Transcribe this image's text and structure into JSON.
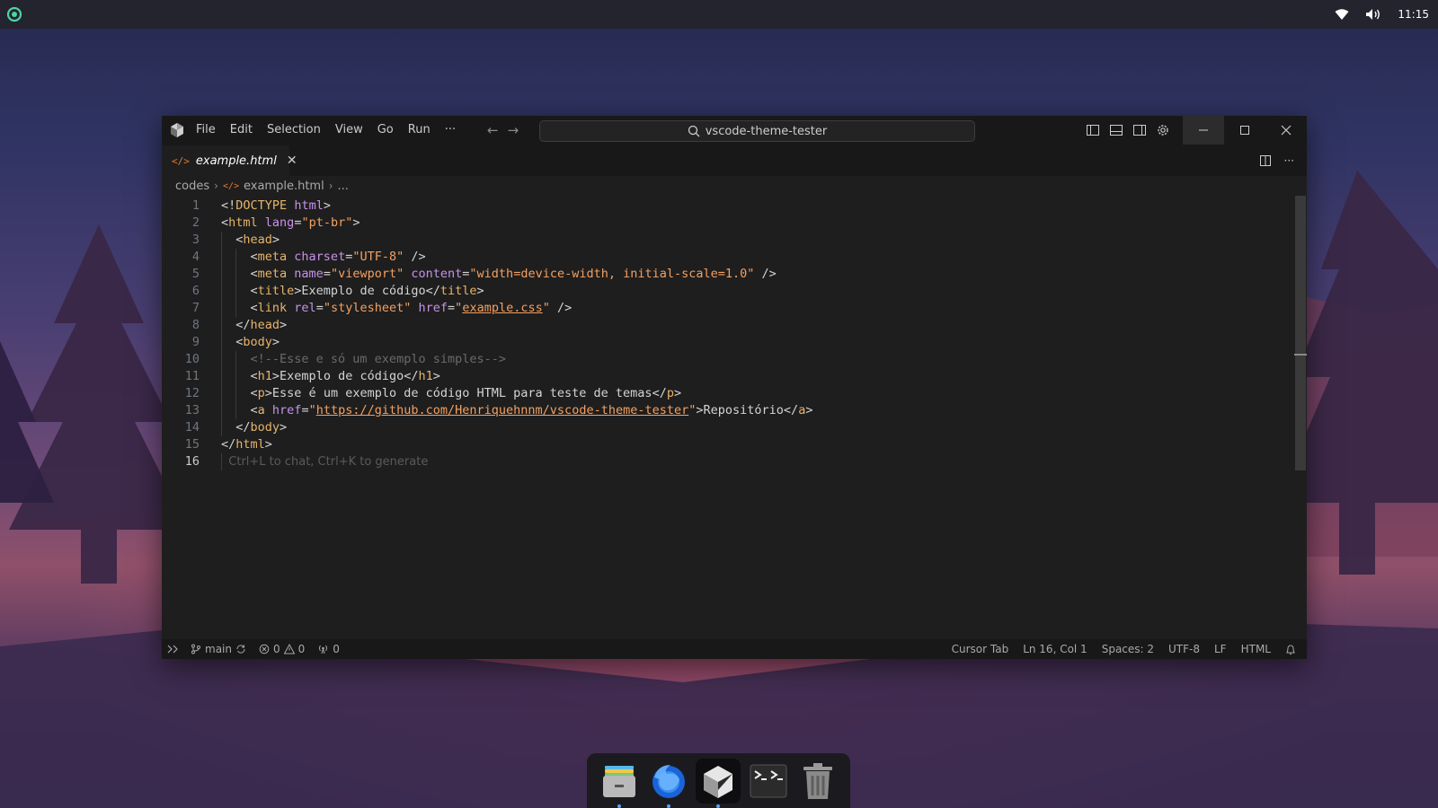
{
  "desktop": {
    "clock": "11:15",
    "tray_icons": [
      "wifi-icon",
      "volume-icon"
    ]
  },
  "window": {
    "menu": [
      "File",
      "Edit",
      "Selection",
      "View",
      "Go",
      "Run",
      "···"
    ],
    "search": "vscode-theme-tester",
    "tab": {
      "label": "example.html"
    },
    "breadcrumb": [
      "codes",
      "example.html",
      "..."
    ],
    "code_lines": [
      [
        [
          "t-punct",
          "<!"
        ],
        [
          "t-tag",
          "DOCTYPE"
        ],
        [
          "t-punct",
          " "
        ],
        [
          "t-keyword",
          "html"
        ],
        [
          "t-punct",
          ">"
        ]
      ],
      [
        [
          "t-punct",
          "<"
        ],
        [
          "t-tag",
          "html"
        ],
        [
          "t-punct",
          " "
        ],
        [
          "t-attr",
          "lang"
        ],
        [
          "t-punct",
          "="
        ],
        [
          "t-str",
          "\"pt-br\""
        ],
        [
          "t-punct",
          ">"
        ]
      ],
      [
        [
          "t-punct",
          "  <"
        ],
        [
          "t-tag",
          "head"
        ],
        [
          "t-punct",
          ">"
        ]
      ],
      [
        [
          "t-punct",
          "    <"
        ],
        [
          "t-tag",
          "meta"
        ],
        [
          "t-punct",
          " "
        ],
        [
          "t-attr",
          "charset"
        ],
        [
          "t-punct",
          "="
        ],
        [
          "t-str",
          "\"UTF-8\""
        ],
        [
          "t-punct",
          " />"
        ]
      ],
      [
        [
          "t-punct",
          "    <"
        ],
        [
          "t-tag",
          "meta"
        ],
        [
          "t-punct",
          " "
        ],
        [
          "t-attr",
          "name"
        ],
        [
          "t-punct",
          "="
        ],
        [
          "t-str",
          "\"viewport\""
        ],
        [
          "t-punct",
          " "
        ],
        [
          "t-attr",
          "content"
        ],
        [
          "t-punct",
          "="
        ],
        [
          "t-str",
          "\"width=device-width, initial-scale=1.0\""
        ],
        [
          "t-punct",
          " />"
        ]
      ],
      [
        [
          "t-punct",
          "    <"
        ],
        [
          "t-tag",
          "title"
        ],
        [
          "t-punct",
          ">"
        ],
        [
          "t-text",
          "Exemplo de código"
        ],
        [
          "t-punct",
          "</"
        ],
        [
          "t-tag",
          "title"
        ],
        [
          "t-punct",
          ">"
        ]
      ],
      [
        [
          "t-punct",
          "    <"
        ],
        [
          "t-tag",
          "link"
        ],
        [
          "t-punct",
          " "
        ],
        [
          "t-attr",
          "rel"
        ],
        [
          "t-punct",
          "="
        ],
        [
          "t-str",
          "\"stylesheet\""
        ],
        [
          "t-punct",
          " "
        ],
        [
          "t-attr",
          "href"
        ],
        [
          "t-punct",
          "="
        ],
        [
          "t-str",
          "\""
        ],
        [
          "t-link",
          "example.css"
        ],
        [
          "t-str",
          "\""
        ],
        [
          "t-punct",
          " />"
        ]
      ],
      [
        [
          "t-punct",
          "  </"
        ],
        [
          "t-tag",
          "head"
        ],
        [
          "t-punct",
          ">"
        ]
      ],
      [
        [
          "t-punct",
          "  <"
        ],
        [
          "t-tag",
          "body"
        ],
        [
          "t-punct",
          ">"
        ]
      ],
      [
        [
          "t-comment",
          "    <!--Esse e só um exemplo simples-->"
        ]
      ],
      [
        [
          "t-punct",
          "    <"
        ],
        [
          "t-tag",
          "h1"
        ],
        [
          "t-punct",
          ">"
        ],
        [
          "t-text",
          "Exemplo de código"
        ],
        [
          "t-punct",
          "</"
        ],
        [
          "t-tag",
          "h1"
        ],
        [
          "t-punct",
          ">"
        ]
      ],
      [
        [
          "t-punct",
          "    <"
        ],
        [
          "t-tag",
          "p"
        ],
        [
          "t-punct",
          ">"
        ],
        [
          "t-text",
          "Esse é um exemplo de código HTML para teste de temas"
        ],
        [
          "t-punct",
          "</"
        ],
        [
          "t-tag",
          "p"
        ],
        [
          "t-punct",
          ">"
        ]
      ],
      [
        [
          "t-punct",
          "    <"
        ],
        [
          "t-tag",
          "a"
        ],
        [
          "t-punct",
          " "
        ],
        [
          "t-attr",
          "href"
        ],
        [
          "t-punct",
          "="
        ],
        [
          "t-str",
          "\""
        ],
        [
          "t-link",
          "https://github.com/Henriquehnnm/vscode-theme-tester"
        ],
        [
          "t-str",
          "\""
        ],
        [
          "t-punct",
          ">"
        ],
        [
          "t-text",
          "Repositório"
        ],
        [
          "t-punct",
          "</"
        ],
        [
          "t-tag",
          "a"
        ],
        [
          "t-punct",
          ">"
        ]
      ],
      [
        [
          "t-punct",
          "  </"
        ],
        [
          "t-tag",
          "body"
        ],
        [
          "t-punct",
          ">"
        ]
      ],
      [
        [
          "t-punct",
          "</"
        ],
        [
          "t-tag",
          "html"
        ],
        [
          "t-punct",
          ">"
        ]
      ],
      []
    ],
    "line_numbers": [
      "1",
      "2",
      "3",
      "4",
      "5",
      "6",
      "7",
      "8",
      "9",
      "10",
      "11",
      "12",
      "13",
      "14",
      "15",
      "16"
    ],
    "placeholder": "Ctrl+L to chat, Ctrl+K to generate",
    "status": {
      "branch": "main",
      "errors": "0",
      "warnings": "0",
      "ports": "0",
      "cursor_tab": "Cursor Tab",
      "position": "Ln 16, Col 1",
      "spaces": "Spaces: 2",
      "encoding": "UTF-8",
      "eol": "LF",
      "language": "HTML"
    }
  },
  "dock": {
    "apps": [
      "files-icon",
      "firefox-icon",
      "cursor-icon",
      "terminal-icon",
      "trash-icon"
    ]
  }
}
